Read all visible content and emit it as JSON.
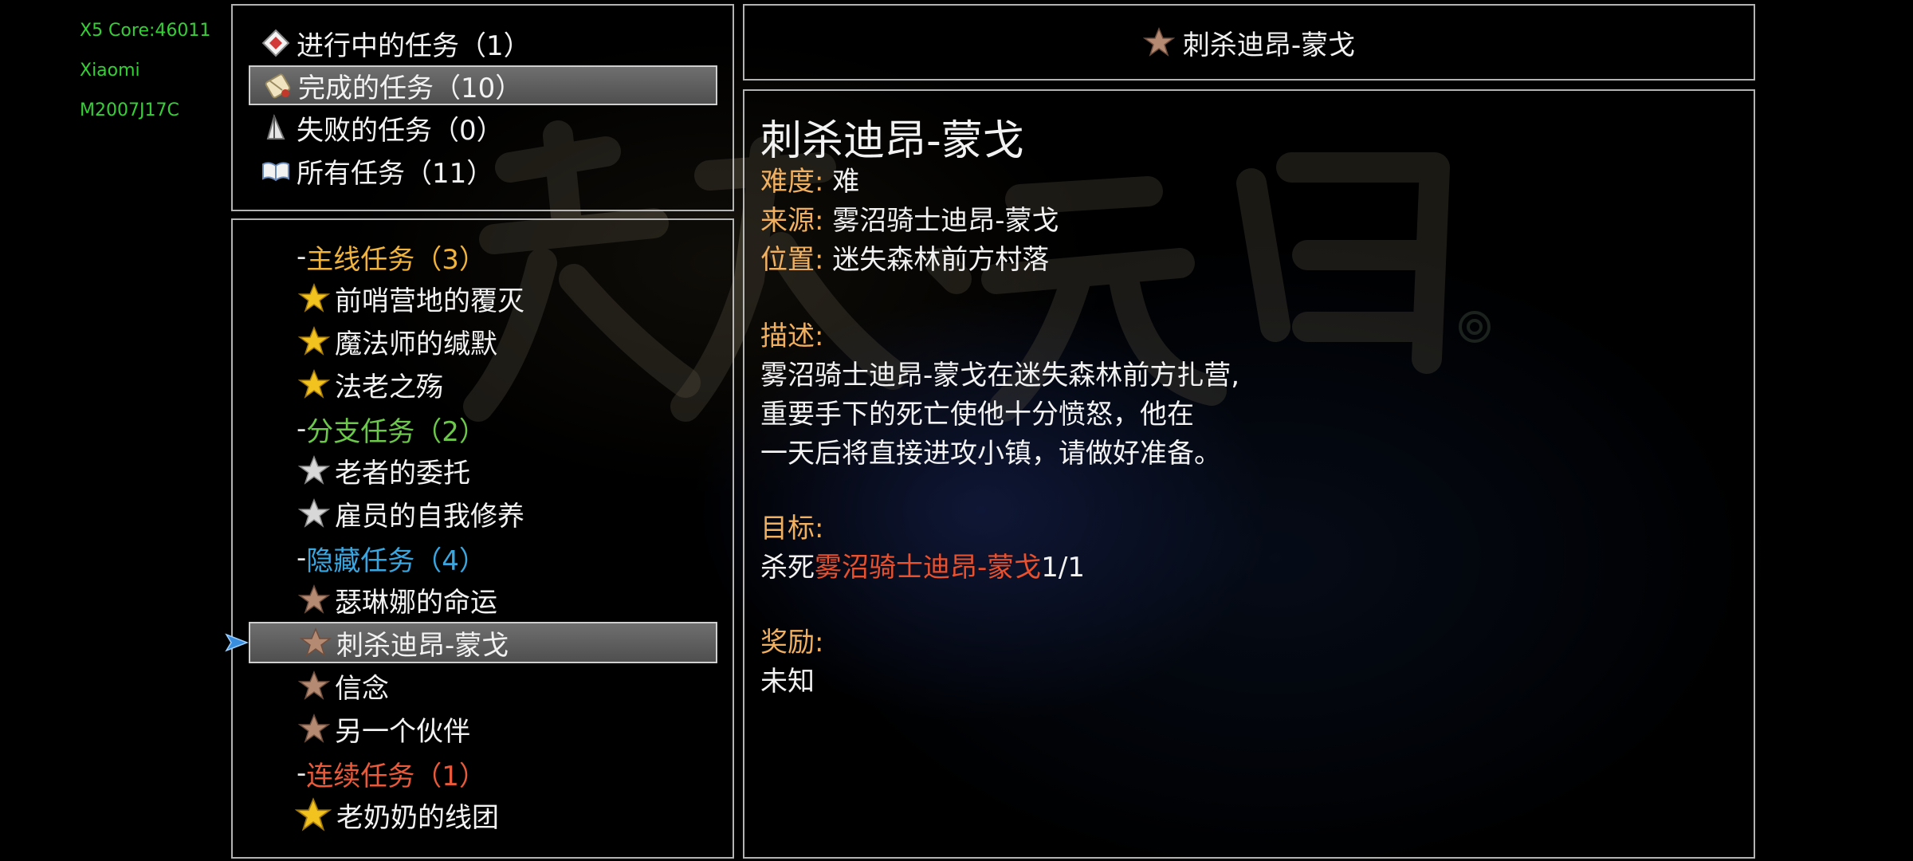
{
  "debug": {
    "line1": "X5 Core:46011",
    "line2": "Xiaomi",
    "line3": "M2007J17C"
  },
  "categories": [
    {
      "label": "进行中的任务（1）",
      "icon": "envelope-icon",
      "selected": false
    },
    {
      "label": "完成的任务（10）",
      "icon": "scroll-icon",
      "selected": true
    },
    {
      "label": "失败的任务（0）",
      "icon": "broken-sail-icon",
      "selected": false
    },
    {
      "label": "所有任务（11）",
      "icon": "open-book-icon",
      "selected": false
    }
  ],
  "groups": {
    "main": {
      "dash": "-",
      "label": "主线任务（3）",
      "color": "#f0b43c"
    },
    "side": {
      "dash": "-",
      "label": "分支任务（2）",
      "color": "#6cc84a"
    },
    "hidden": {
      "dash": "-",
      "label": "隐藏任务（4）",
      "color": "#3aa6e0"
    },
    "chain": {
      "dash": "-",
      "label": "连续任务（1）",
      "color": "#e85a3a"
    }
  },
  "quests": {
    "main": [
      "前哨营地的覆灭",
      "魔法师的缄默",
      "法老之殇"
    ],
    "side": [
      "老者的委托",
      "雇员的自我修养"
    ],
    "hidden": [
      "瑟琳娜的命运",
      "刺杀迪昂-蒙戈",
      "信念",
      "另一个伙伴"
    ],
    "chain": [
      "老奶奶的线团"
    ]
  },
  "selected_quest": "刺杀迪昂-蒙戈",
  "star_colors": {
    "gold": "#f2c21e",
    "silver": "#d8d8d8",
    "bronze": "#b58a72"
  },
  "title_bar": {
    "label": "刺杀迪昂-蒙戈",
    "icon": "bronze-star-icon"
  },
  "detail": {
    "title": "刺杀迪昂-蒙戈",
    "difficulty_label": "难度:",
    "difficulty": "难",
    "source_label": "来源:",
    "source": "雾沼骑士迪昂-蒙戈",
    "location_label": "位置:",
    "location": "迷失森林前方村落",
    "desc_label": "描述:",
    "desc_lines": [
      "雾沼骑士迪昂-蒙戈在迷失森林前方扎营,",
      "重要手下的死亡使他十分愤怒，他在",
      "一天后将直接进攻小镇，请做好准备。"
    ],
    "objective_label": "目标:",
    "objective_prefix": "杀死",
    "objective_target": "雾沼骑士迪昂-蒙戈",
    "objective_progress": "1/1",
    "reward_label": "奖励:",
    "reward": "未知"
  },
  "accent_colors": {
    "label": "#f0b060",
    "target": "#e8502e",
    "debug": "#35d035"
  }
}
